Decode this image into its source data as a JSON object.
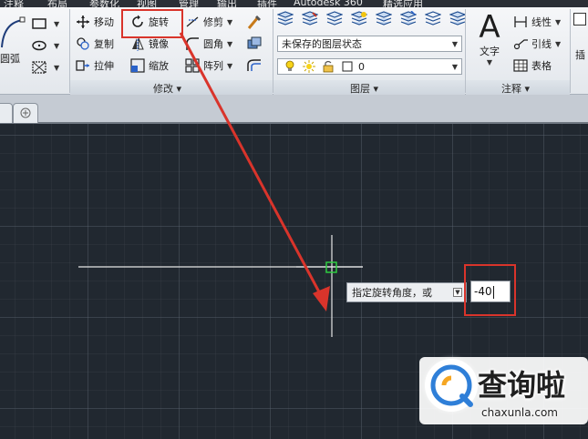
{
  "menu_tabs": [
    "注释",
    "布局",
    "参数化",
    "视图",
    "管理",
    "输出",
    "插件",
    "Autodesk 360",
    "精选应用"
  ],
  "draw_panel": {
    "arc_label": "圆弧"
  },
  "modify_panel": {
    "title": "修改",
    "tools": {
      "move": "移动",
      "rotate": "旋转",
      "trim": "修剪",
      "copy": "复制",
      "mirror": "镜像",
      "fillet": "圆角",
      "stretch": "拉伸",
      "scale": "缩放",
      "array": "阵列"
    }
  },
  "layers_panel": {
    "title": "图层",
    "layer_state": "未保存的图层状态",
    "current_layer": "0"
  },
  "annotation_panel": {
    "title": "注释",
    "text_label": "文字",
    "linear": "线性",
    "leader": "引线",
    "table": "表格"
  },
  "far_right_label": "插",
  "command": {
    "prompt": "指定旋转角度，或",
    "angle_value": "-40"
  },
  "watermark": {
    "brand": "查询啦",
    "site": "chaxunla.com"
  },
  "colors": {
    "highlight": "#d9342b",
    "canvas_bg": "#212830",
    "crosshair": "#e6e6e6",
    "pickbox": "#2ecc40"
  },
  "icons": [
    "move-icon",
    "rotate-icon",
    "trim-icon",
    "copy-icon",
    "mirror-icon",
    "fillet-icon",
    "stretch-icon",
    "scale-icon",
    "array-icon",
    "brush-icon",
    "text-icon",
    "linear-icon",
    "leader-icon",
    "table-icon",
    "lightbulb-icon",
    "sun-icon",
    "lock-icon"
  ]
}
